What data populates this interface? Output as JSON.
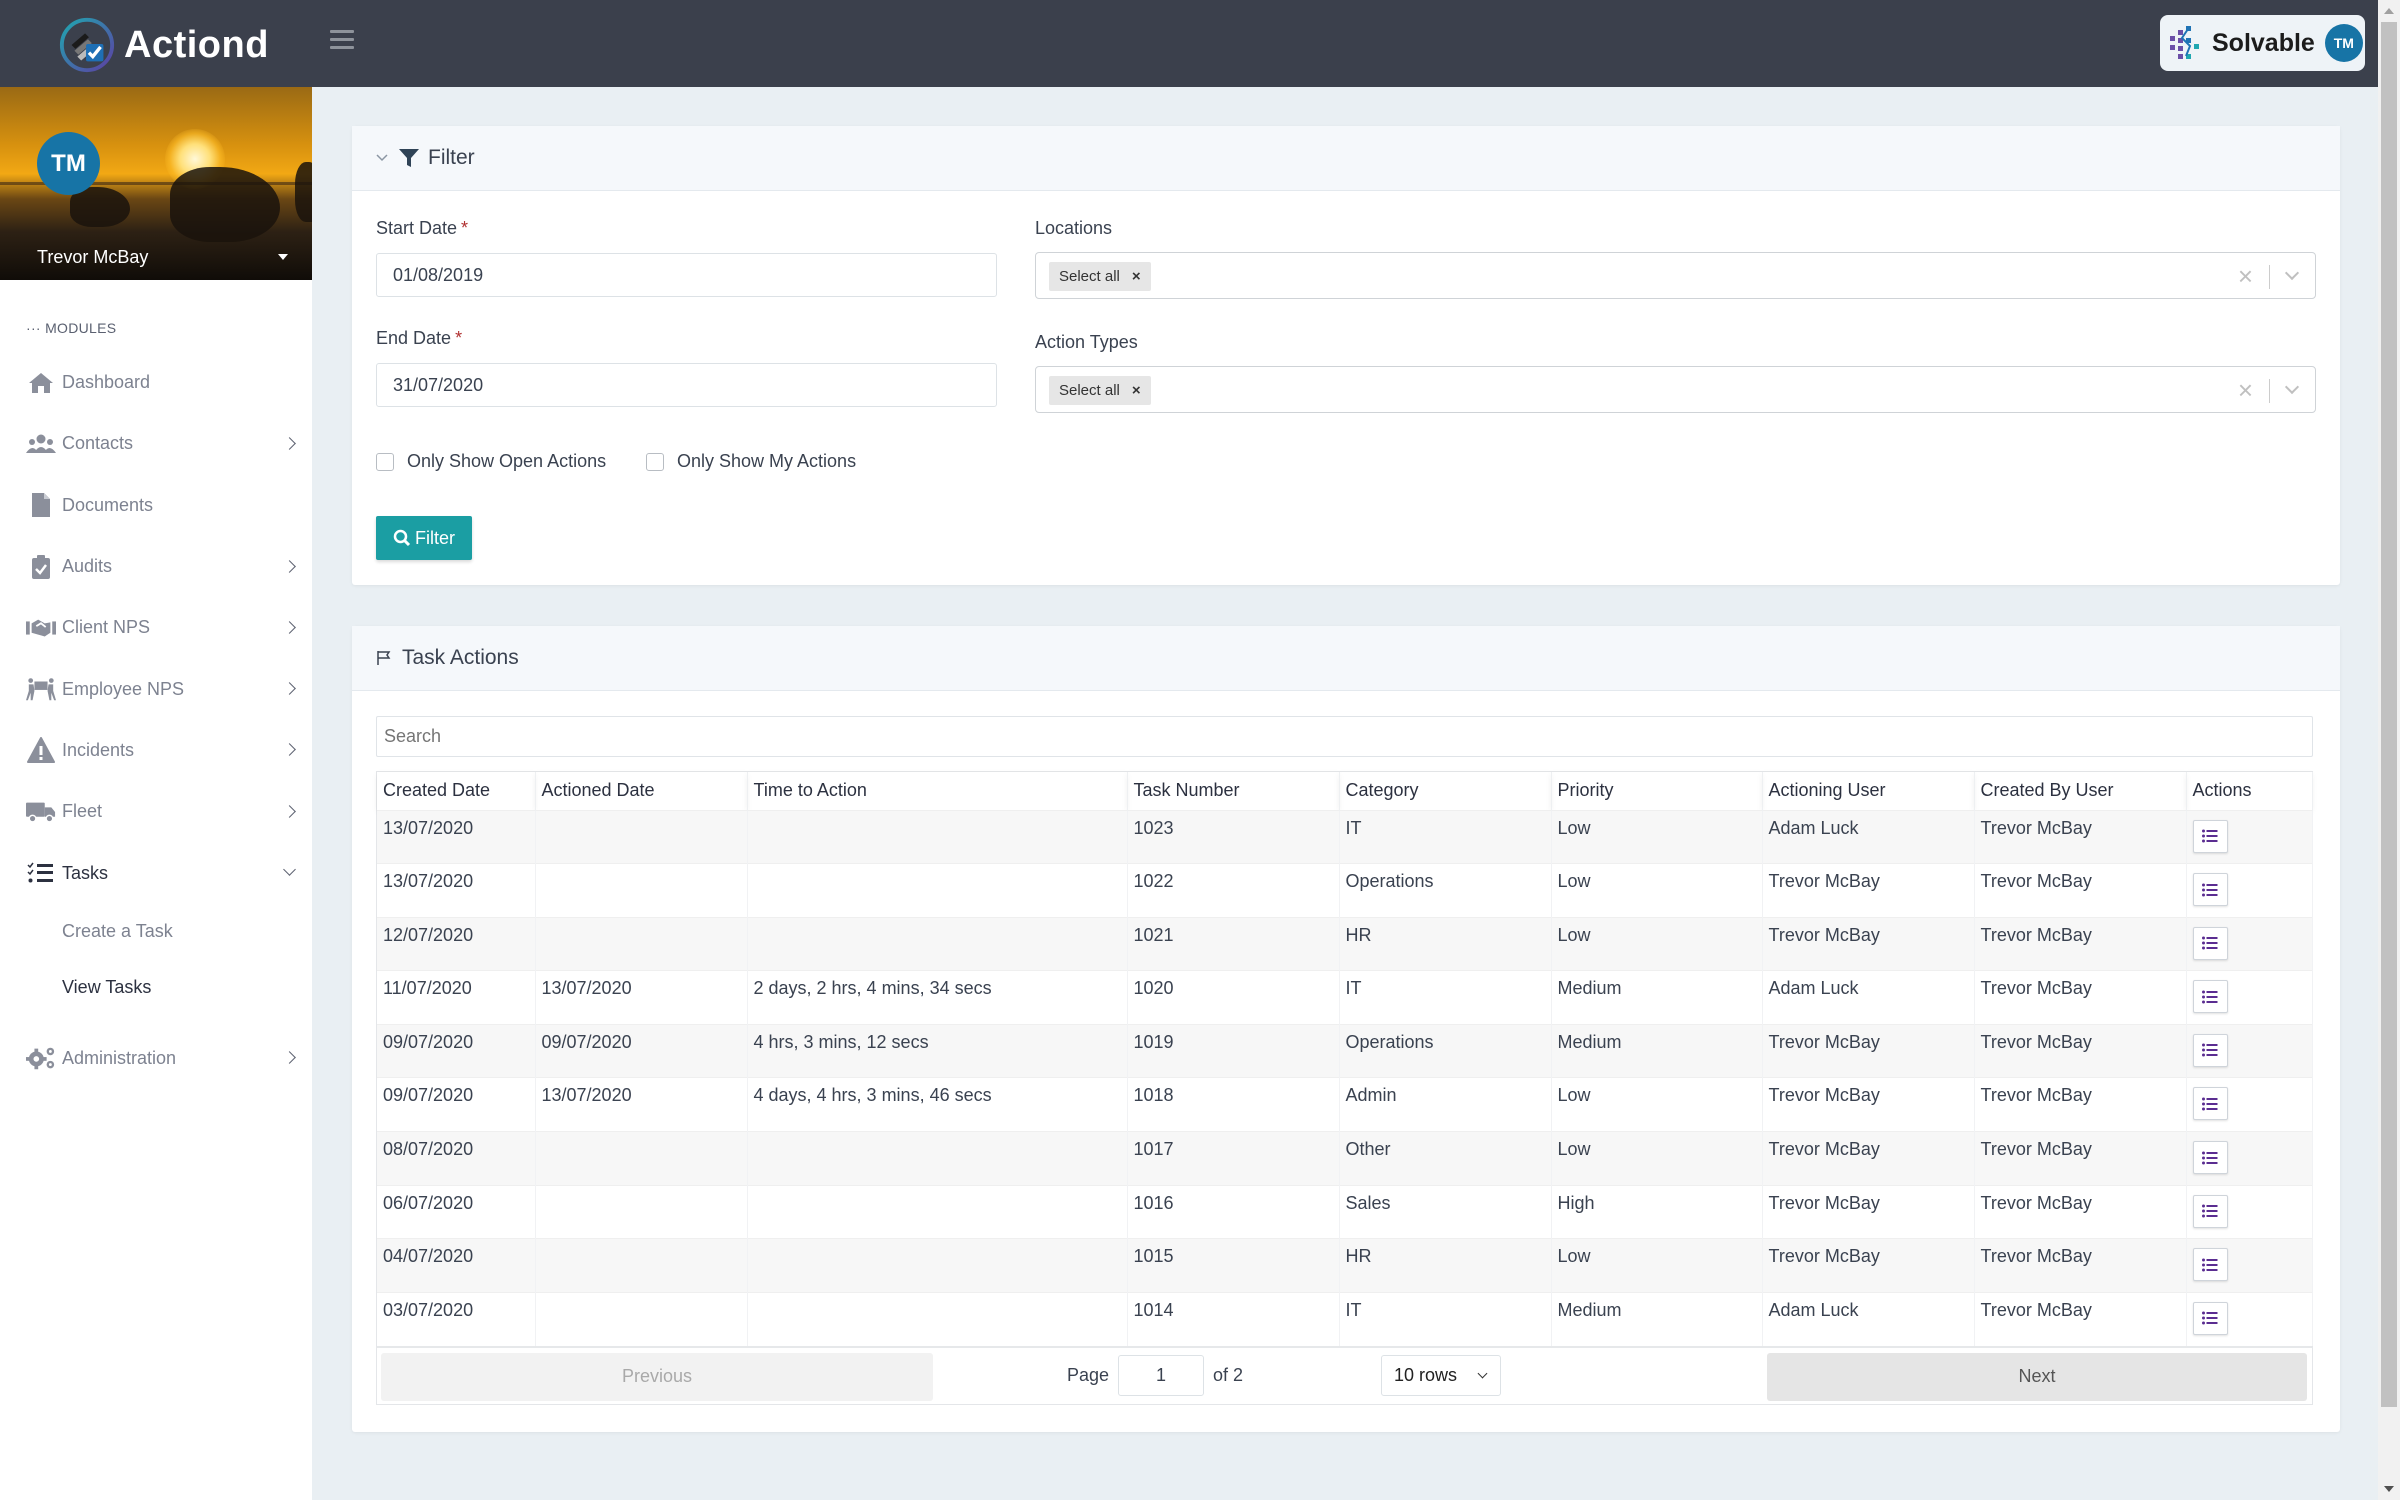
{
  "app": {
    "name": "Actiond",
    "brand_partner": "Solvable",
    "user_initials": "TM"
  },
  "sidebar": {
    "user_name": "Trevor McBay",
    "user_initials": "TM",
    "section_label": "MODULES",
    "items": [
      {
        "label": "Dashboard",
        "icon": "home-icon",
        "has_children": false
      },
      {
        "label": "Contacts",
        "icon": "users-icon",
        "has_children": true
      },
      {
        "label": "Documents",
        "icon": "file-icon",
        "has_children": false
      },
      {
        "label": "Audits",
        "icon": "clipboard-check-icon",
        "has_children": true
      },
      {
        "label": "Client NPS",
        "icon": "handshake-icon",
        "has_children": true
      },
      {
        "label": "Employee NPS",
        "icon": "people-carry-icon",
        "has_children": true
      },
      {
        "label": "Incidents",
        "icon": "warning-icon",
        "has_children": true
      },
      {
        "label": "Fleet",
        "icon": "truck-icon",
        "has_children": true
      },
      {
        "label": "Tasks",
        "icon": "tasks-icon",
        "has_children": true,
        "expanded": true,
        "active": true
      },
      {
        "label": "Administration",
        "icon": "cogs-icon",
        "has_children": true
      }
    ],
    "task_subitems": [
      {
        "label": "Create a Task",
        "active": false
      },
      {
        "label": "View Tasks",
        "active": true
      }
    ]
  },
  "filter": {
    "title": "Filter",
    "start_date_label": "Start Date",
    "start_date_value": "01/08/2019",
    "end_date_label": "End Date",
    "end_date_value": "31/07/2020",
    "required_marker": "*",
    "locations_label": "Locations",
    "locations_chip": "Select all",
    "action_types_label": "Action Types",
    "action_types_chip": "Select all",
    "chip_remove": "×",
    "clear_symbol": "×",
    "open_actions_label": "Only Show Open Actions",
    "open_actions_checked": false,
    "my_actions_label": "Only Show My Actions",
    "my_actions_checked": false,
    "button_label": "Filter"
  },
  "tasks": {
    "title": "Task Actions",
    "search_placeholder": "Search",
    "columns": [
      "Created Date",
      "Actioned Date",
      "Time to Action",
      "Task Number",
      "Category",
      "Priority",
      "Actioning User",
      "Created By User",
      "Actions"
    ],
    "rows": [
      {
        "created": "13/07/2020",
        "actioned": "",
        "time_to_action": "",
        "task_number": "1023",
        "category": "IT",
        "priority": "Low",
        "actioning_user": "Adam Luck",
        "created_by": "Trevor McBay"
      },
      {
        "created": "13/07/2020",
        "actioned": "",
        "time_to_action": "",
        "task_number": "1022",
        "category": "Operations",
        "priority": "Low",
        "actioning_user": "Trevor McBay",
        "created_by": "Trevor McBay"
      },
      {
        "created": "12/07/2020",
        "actioned": "",
        "time_to_action": "",
        "task_number": "1021",
        "category": "HR",
        "priority": "Low",
        "actioning_user": "Trevor McBay",
        "created_by": "Trevor McBay"
      },
      {
        "created": "11/07/2020",
        "actioned": "13/07/2020",
        "time_to_action": "2 days, 2 hrs, 4 mins, 34 secs",
        "task_number": "1020",
        "category": "IT",
        "priority": "Medium",
        "actioning_user": "Adam Luck",
        "created_by": "Trevor McBay"
      },
      {
        "created": "09/07/2020",
        "actioned": "09/07/2020",
        "time_to_action": "4 hrs, 3 mins, 12 secs",
        "task_number": "1019",
        "category": "Operations",
        "priority": "Medium",
        "actioning_user": "Trevor McBay",
        "created_by": "Trevor McBay"
      },
      {
        "created": "09/07/2020",
        "actioned": "13/07/2020",
        "time_to_action": "4 days, 4 hrs, 3 mins, 46 secs",
        "task_number": "1018",
        "category": "Admin",
        "priority": "Low",
        "actioning_user": "Trevor McBay",
        "created_by": "Trevor McBay"
      },
      {
        "created": "08/07/2020",
        "actioned": "",
        "time_to_action": "",
        "task_number": "1017",
        "category": "Other",
        "priority": "Low",
        "actioning_user": "Trevor McBay",
        "created_by": "Trevor McBay"
      },
      {
        "created": "06/07/2020",
        "actioned": "",
        "time_to_action": "",
        "task_number": "1016",
        "category": "Sales",
        "priority": "High",
        "actioning_user": "Trevor McBay",
        "created_by": "Trevor McBay"
      },
      {
        "created": "04/07/2020",
        "actioned": "",
        "time_to_action": "",
        "task_number": "1015",
        "category": "HR",
        "priority": "Low",
        "actioning_user": "Trevor McBay",
        "created_by": "Trevor McBay"
      },
      {
        "created": "03/07/2020",
        "actioned": "",
        "time_to_action": "",
        "task_number": "1014",
        "category": "IT",
        "priority": "Medium",
        "actioning_user": "Adam Luck",
        "created_by": "Trevor McBay"
      }
    ],
    "pagination": {
      "previous_label": "Previous",
      "next_label": "Next",
      "page_label": "Page",
      "current_page": "1",
      "of_label": "of 2",
      "rows_per_page": "10 rows"
    }
  },
  "colors": {
    "topbar": "#3b404c",
    "accent_teal": "#1b9ea3",
    "avatar_blue": "#1774a6",
    "action_icon_purple": "#5b2d91"
  }
}
